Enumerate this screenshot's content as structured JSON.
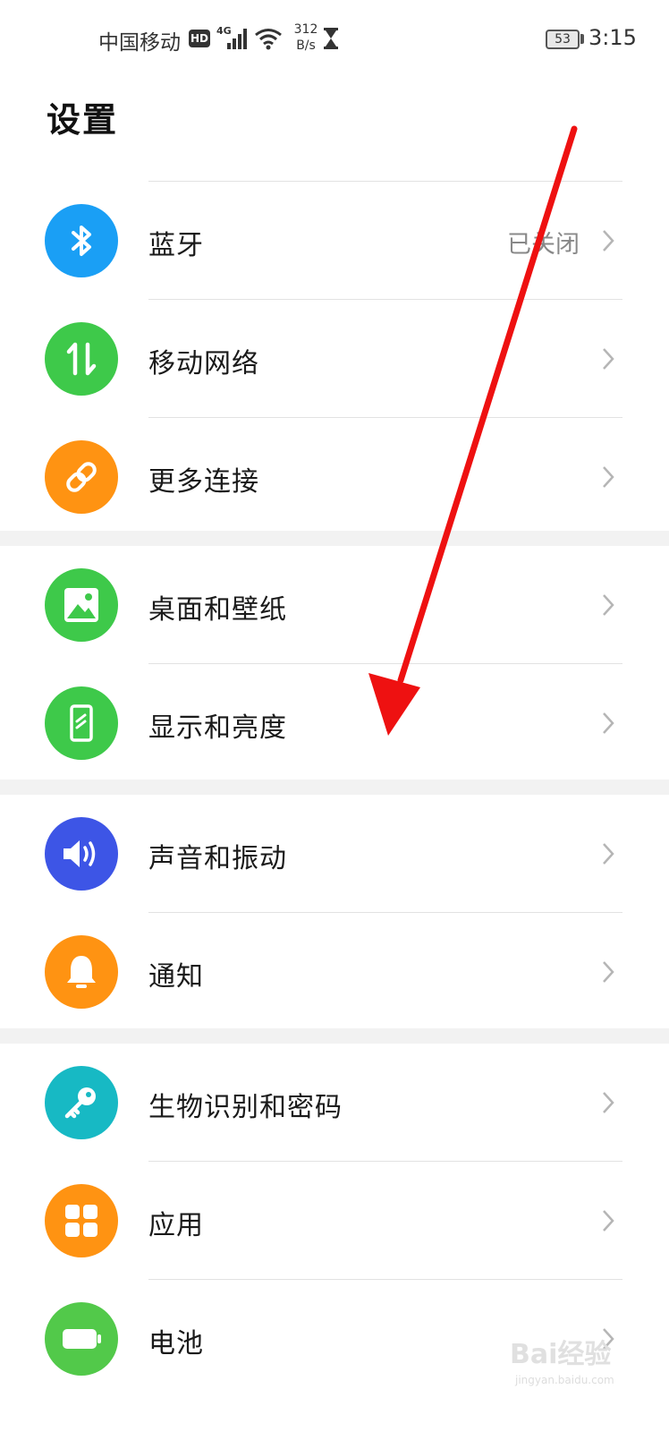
{
  "status_bar": {
    "carrier": "中国移动",
    "hd": "HD",
    "network": "4G",
    "speed_value": "312",
    "speed_unit": "B/s",
    "battery": "53",
    "time": "3:15"
  },
  "page": {
    "title": "设置"
  },
  "groups": [
    {
      "items": [
        {
          "label": "蓝牙",
          "status": "已关闭",
          "icon": "bluetooth-icon",
          "color": "#1a9ff5"
        },
        {
          "label": "移动网络",
          "status": "",
          "icon": "mobile-data-icon",
          "color": "#3ec94a"
        },
        {
          "label": "更多连接",
          "status": "",
          "icon": "link-icon",
          "color": "#ff9312"
        }
      ]
    },
    {
      "items": [
        {
          "label": "桌面和壁纸",
          "status": "",
          "icon": "wallpaper-icon",
          "color": "#3ec94a"
        },
        {
          "label": "显示和亮度",
          "status": "",
          "icon": "display-icon",
          "color": "#3ec94a"
        }
      ]
    },
    {
      "items": [
        {
          "label": "声音和振动",
          "status": "",
          "icon": "sound-icon",
          "color": "#3d55e6"
        },
        {
          "label": "通知",
          "status": "",
          "icon": "bell-icon",
          "color": "#ff9312"
        }
      ]
    },
    {
      "items": [
        {
          "label": "生物识别和密码",
          "status": "",
          "icon": "key-icon",
          "color": "#17b9c4"
        },
        {
          "label": "应用",
          "status": "",
          "icon": "apps-grid-icon",
          "color": "#ff9312"
        },
        {
          "label": "电池",
          "status": "",
          "icon": "battery-icon",
          "color": "#52c94a"
        }
      ]
    }
  ],
  "annotation": {
    "color": "#ee1111"
  },
  "watermark": {
    "text": "Bai经验",
    "sub": "jingyan.baidu.com"
  }
}
